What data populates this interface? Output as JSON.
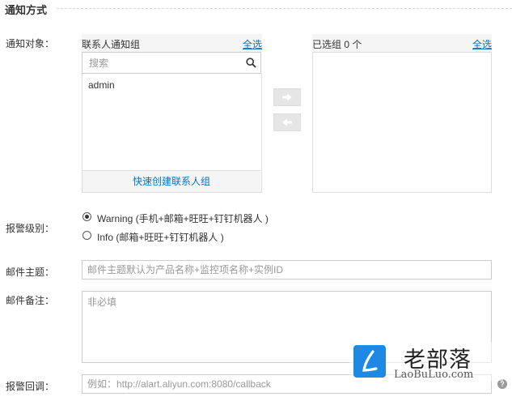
{
  "section": {
    "title": "通知方式"
  },
  "labels": {
    "notify_target": "通知对象：",
    "alarm_level": "报警级别：",
    "email_subject": "邮件主题：",
    "email_note": "邮件备注：",
    "alarm_callback": "报警回调："
  },
  "contact_panel": {
    "title": "联系人通知组",
    "select_all": "全选",
    "search_placeholder": "搜索",
    "items": [
      "admin"
    ],
    "footer_link": "快速创建联系人组"
  },
  "selected_panel": {
    "title": "已选组 0 个",
    "select_all": "全选"
  },
  "transfer": {
    "add_icon": "arrow-right-icon",
    "remove_icon": "arrow-left-icon"
  },
  "levels": [
    {
      "label": "Warning (手机+邮箱+旺旺+钉钉机器人 )",
      "checked": true
    },
    {
      "label": "Info (邮箱+旺旺+钉钉机器人 )",
      "checked": false
    }
  ],
  "email_subject": {
    "value": "",
    "placeholder": "邮件主题默认为产品名称+监控项名称+实例ID"
  },
  "email_note": {
    "value": "",
    "placeholder": "非必填"
  },
  "callback": {
    "value": "",
    "placeholder": "例如：http://alart.aliyun.com:8080/callback"
  },
  "watermark": {
    "cn": "老部落",
    "en": "LaoBuLuo.com"
  },
  "colors": {
    "link": "#0072c6",
    "panel_bg": "#f5f5f5",
    "border": "#dddddd",
    "watermark_blue": "#1e88e5"
  }
}
